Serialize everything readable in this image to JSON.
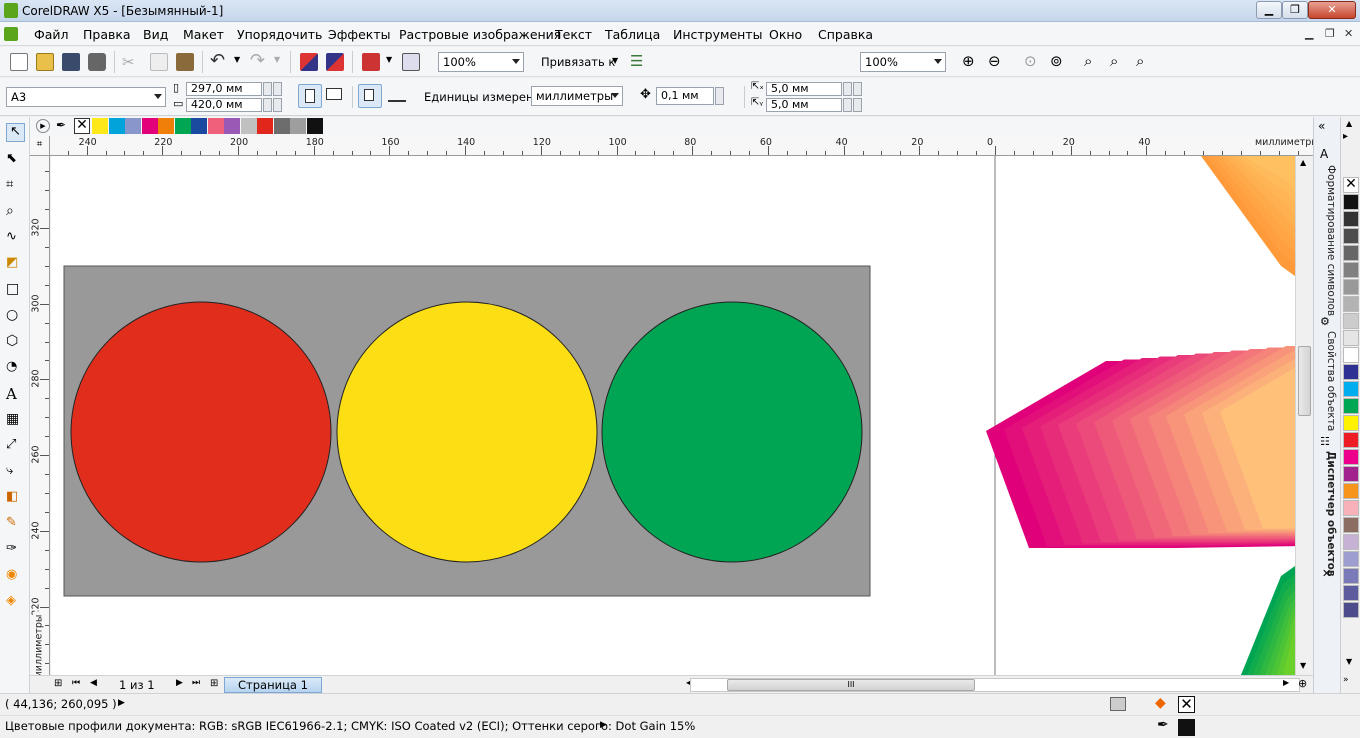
{
  "window": {
    "title": "CorelDRAW X5 - [Безымянный-1]"
  },
  "menu": [
    "Файл",
    "Правка",
    "Вид",
    "Макет",
    "Упорядочить",
    "Эффекты",
    "Растровые изображения",
    "Текст",
    "Таблица",
    "Инструменты",
    "Окно",
    "Справка"
  ],
  "standard_toolbar": {
    "zoom_value": "100%",
    "snap_label": "Привязать к",
    "zoom_value_2": "100%"
  },
  "property_bar": {
    "paper_size": "A3",
    "width": "297,0 мм",
    "height": "420,0 мм",
    "units_label": "Единицы измерения:",
    "units_value": "миллиметры",
    "nudge": "0,1 мм",
    "dup_x": "5,0 мм",
    "dup_y": "5,0 мм"
  },
  "colors": {
    "palette_strip": [
      "#ffe81a",
      "#00a3da",
      "#8896cc",
      "#e2007a",
      "#f07f09",
      "#00a651",
      "#1a4aa0",
      "#f0607a",
      "#9b59b6",
      "#c0c0c0",
      "#e1261c",
      "#6d6d6d",
      "#9e9e9e",
      "#111111"
    ],
    "side_palette": [
      "#111111",
      "#333333",
      "#4d4d4d",
      "#666666",
      "#808080",
      "#999999",
      "#b3b3b3",
      "#cccccc",
      "#e5e5e5",
      "#ffffff",
      "#2e3192",
      "#00aeef",
      "#00a651",
      "#fff200",
      "#ed1c24",
      "#ec008c",
      "#a3238e",
      "#f7941d",
      "#f9b1b9",
      "#8c6d62",
      "#c7b2d6",
      "#9e9ed0",
      "#7a7ab8",
      "#5b5b9e",
      "#4c4c8a"
    ],
    "panel_gray": "#999999",
    "circle_red": "#e12d1c",
    "circle_yellow": "#fbdf14",
    "circle_green": "#00a553"
  },
  "ruler": {
    "h_labels": [
      "240",
      "220",
      "200",
      "180",
      "160",
      "140",
      "120",
      "100",
      "80",
      "60",
      "40",
      "20",
      "0",
      "20",
      "40"
    ],
    "h_unit": "миллиметры",
    "v_labels": [
      "320",
      "300",
      "280",
      "260",
      "240",
      "220"
    ],
    "v_unit": "миллиметры"
  },
  "docker_tabs": [
    "Форматирование символов",
    "Свойства объекта",
    "Диспетчер объектов"
  ],
  "page_nav": {
    "counter": "1 из 1",
    "page_tab": "Страница 1"
  },
  "status": {
    "coords": "( 44,136; 260,095 )",
    "color_profiles": "Цветовые профили документа: RGB: sRGB IEC61966-2.1; CMYK: ISO Coated v2 (ECI); Оттенки серого: Dot Gain 15%"
  },
  "icons": [
    "app-icon",
    "new-icon",
    "open-icon",
    "save-icon",
    "print-icon",
    "cut-icon",
    "copy-icon",
    "paste-icon",
    "undo-icon",
    "redo-icon",
    "import-icon",
    "export-icon",
    "publish-icon",
    "zoom-in-icon",
    "zoom-out-icon",
    "pick-tool-icon",
    "shape-tool-icon",
    "crop-tool-icon",
    "zoom-tool-icon",
    "freehand-tool-icon",
    "rectangle-tool-icon",
    "ellipse-tool-icon",
    "polygon-tool-icon",
    "text-tool-icon",
    "table-tool-icon",
    "fill-tool-icon",
    "eyedropper-icon"
  ]
}
